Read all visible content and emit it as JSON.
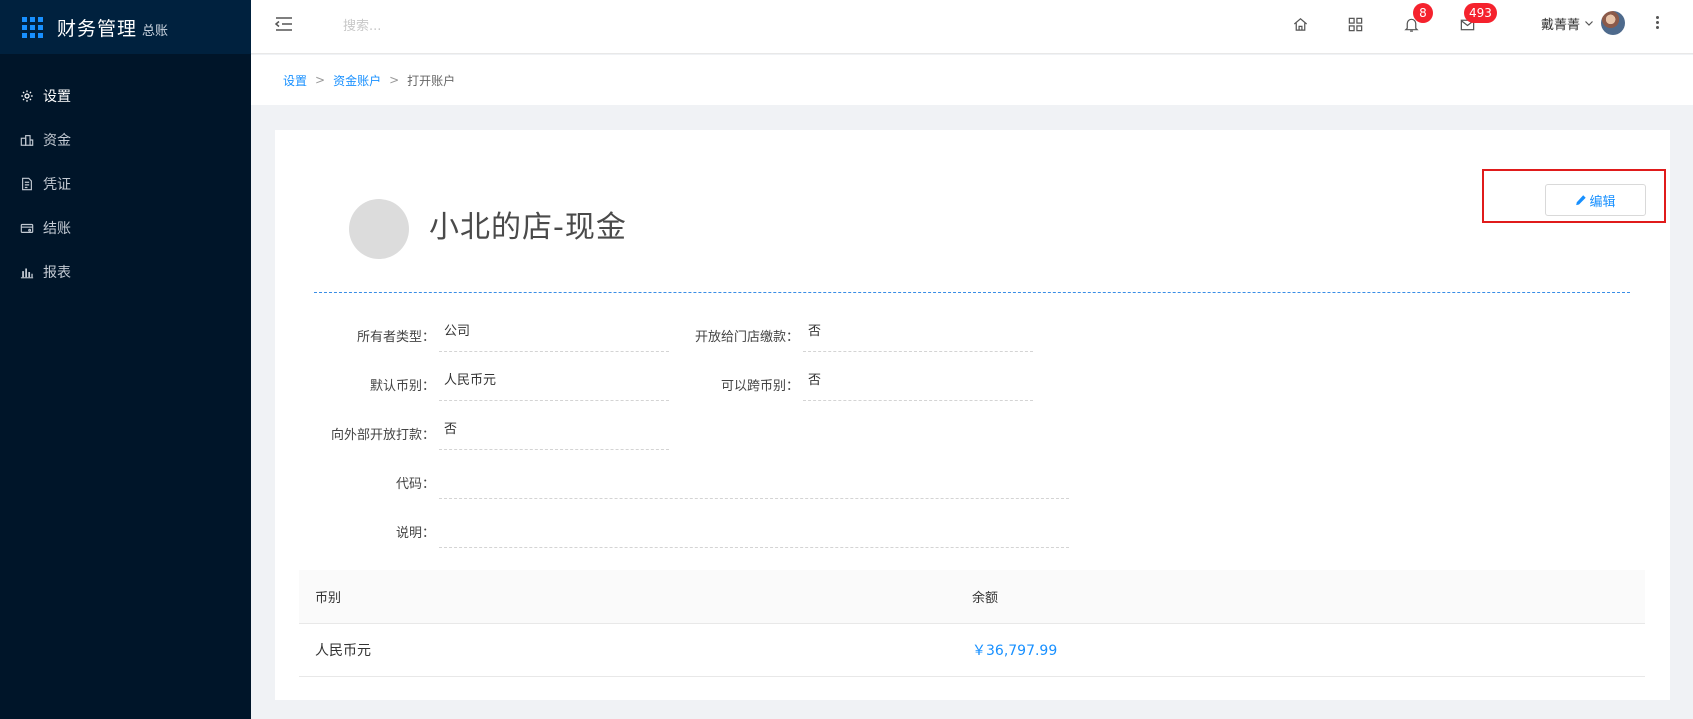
{
  "brand": {
    "title": "财务管理",
    "subtitle": "总账"
  },
  "sidebar": {
    "items": [
      {
        "label": "设置",
        "icon": "gear-icon",
        "active": true
      },
      {
        "label": "资金",
        "icon": "fund-icon",
        "active": false
      },
      {
        "label": "凭证",
        "icon": "voucher-icon",
        "active": false
      },
      {
        "label": "结账",
        "icon": "checkout-icon",
        "active": false
      },
      {
        "label": "报表",
        "icon": "bar-chart-icon",
        "active": false
      }
    ]
  },
  "header": {
    "search_placeholder": "搜索...",
    "notifications_count": "8",
    "messages_count": "493",
    "user_name": "戴菁菁"
  },
  "breadcrumb": {
    "items": [
      "设置",
      "资金账户"
    ],
    "current": "打开账户",
    "separator": ">"
  },
  "account": {
    "title": "小北的店-现金",
    "edit_label": "编辑",
    "fields": {
      "owner_type": {
        "label": "所有者类型：",
        "value": "公司"
      },
      "open_to_store": {
        "label": "开放给门店缴款：",
        "value": "否"
      },
      "default_currency": {
        "label": "默认币别：",
        "value": "人民币元"
      },
      "cross_currency": {
        "label": "可以跨币别：",
        "value": "否"
      },
      "open_external": {
        "label": "向外部开放打款：",
        "value": "否"
      },
      "code": {
        "label": "代码：",
        "value": ""
      },
      "description": {
        "label": "说明：",
        "value": ""
      }
    }
  },
  "balance_table": {
    "headers": [
      "币别",
      "余额"
    ],
    "rows": [
      {
        "currency": "人民币元",
        "balance": "￥36,797.99"
      }
    ]
  },
  "colors": {
    "sidebar_bg": "#001529",
    "accent": "#1890ff",
    "badge": "#f5222d",
    "highlight_box": "#e01b1b"
  }
}
